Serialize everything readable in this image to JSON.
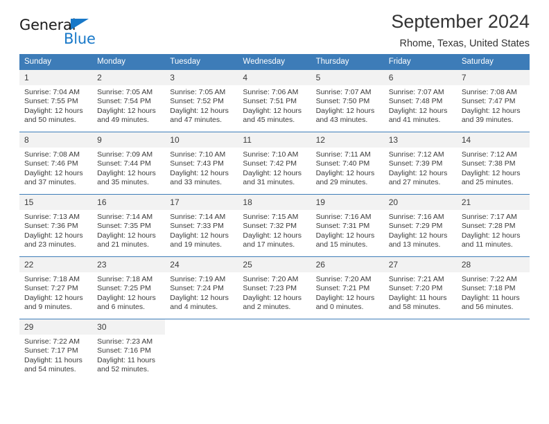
{
  "brand": {
    "name_top": "General",
    "name_bottom": "Blue",
    "triangle_icon": "triangle-icon",
    "accent_color": "#1878c8"
  },
  "header": {
    "title": "September 2024",
    "subtitle": "Rhome, Texas, United States"
  },
  "theme": {
    "header_blue": "#3d7cb8",
    "daynum_gray": "#f2f2f2",
    "text_color": "#3a3a3a"
  },
  "calendar": {
    "weekday_headers": [
      "Sunday",
      "Monday",
      "Tuesday",
      "Wednesday",
      "Thursday",
      "Friday",
      "Saturday"
    ],
    "weeks": [
      [
        {
          "day": "1",
          "sunrise": "Sunrise: 7:04 AM",
          "sunset": "Sunset: 7:55 PM",
          "daylight_1": "Daylight: 12 hours",
          "daylight_2": "and 50 minutes."
        },
        {
          "day": "2",
          "sunrise": "Sunrise: 7:05 AM",
          "sunset": "Sunset: 7:54 PM",
          "daylight_1": "Daylight: 12 hours",
          "daylight_2": "and 49 minutes."
        },
        {
          "day": "3",
          "sunrise": "Sunrise: 7:05 AM",
          "sunset": "Sunset: 7:52 PM",
          "daylight_1": "Daylight: 12 hours",
          "daylight_2": "and 47 minutes."
        },
        {
          "day": "4",
          "sunrise": "Sunrise: 7:06 AM",
          "sunset": "Sunset: 7:51 PM",
          "daylight_1": "Daylight: 12 hours",
          "daylight_2": "and 45 minutes."
        },
        {
          "day": "5",
          "sunrise": "Sunrise: 7:07 AM",
          "sunset": "Sunset: 7:50 PM",
          "daylight_1": "Daylight: 12 hours",
          "daylight_2": "and 43 minutes."
        },
        {
          "day": "6",
          "sunrise": "Sunrise: 7:07 AM",
          "sunset": "Sunset: 7:48 PM",
          "daylight_1": "Daylight: 12 hours",
          "daylight_2": "and 41 minutes."
        },
        {
          "day": "7",
          "sunrise": "Sunrise: 7:08 AM",
          "sunset": "Sunset: 7:47 PM",
          "daylight_1": "Daylight: 12 hours",
          "daylight_2": "and 39 minutes."
        }
      ],
      [
        {
          "day": "8",
          "sunrise": "Sunrise: 7:08 AM",
          "sunset": "Sunset: 7:46 PM",
          "daylight_1": "Daylight: 12 hours",
          "daylight_2": "and 37 minutes."
        },
        {
          "day": "9",
          "sunrise": "Sunrise: 7:09 AM",
          "sunset": "Sunset: 7:44 PM",
          "daylight_1": "Daylight: 12 hours",
          "daylight_2": "and 35 minutes."
        },
        {
          "day": "10",
          "sunrise": "Sunrise: 7:10 AM",
          "sunset": "Sunset: 7:43 PM",
          "daylight_1": "Daylight: 12 hours",
          "daylight_2": "and 33 minutes."
        },
        {
          "day": "11",
          "sunrise": "Sunrise: 7:10 AM",
          "sunset": "Sunset: 7:42 PM",
          "daylight_1": "Daylight: 12 hours",
          "daylight_2": "and 31 minutes."
        },
        {
          "day": "12",
          "sunrise": "Sunrise: 7:11 AM",
          "sunset": "Sunset: 7:40 PM",
          "daylight_1": "Daylight: 12 hours",
          "daylight_2": "and 29 minutes."
        },
        {
          "day": "13",
          "sunrise": "Sunrise: 7:12 AM",
          "sunset": "Sunset: 7:39 PM",
          "daylight_1": "Daylight: 12 hours",
          "daylight_2": "and 27 minutes."
        },
        {
          "day": "14",
          "sunrise": "Sunrise: 7:12 AM",
          "sunset": "Sunset: 7:38 PM",
          "daylight_1": "Daylight: 12 hours",
          "daylight_2": "and 25 minutes."
        }
      ],
      [
        {
          "day": "15",
          "sunrise": "Sunrise: 7:13 AM",
          "sunset": "Sunset: 7:36 PM",
          "daylight_1": "Daylight: 12 hours",
          "daylight_2": "and 23 minutes."
        },
        {
          "day": "16",
          "sunrise": "Sunrise: 7:14 AM",
          "sunset": "Sunset: 7:35 PM",
          "daylight_1": "Daylight: 12 hours",
          "daylight_2": "and 21 minutes."
        },
        {
          "day": "17",
          "sunrise": "Sunrise: 7:14 AM",
          "sunset": "Sunset: 7:33 PM",
          "daylight_1": "Daylight: 12 hours",
          "daylight_2": "and 19 minutes."
        },
        {
          "day": "18",
          "sunrise": "Sunrise: 7:15 AM",
          "sunset": "Sunset: 7:32 PM",
          "daylight_1": "Daylight: 12 hours",
          "daylight_2": "and 17 minutes."
        },
        {
          "day": "19",
          "sunrise": "Sunrise: 7:16 AM",
          "sunset": "Sunset: 7:31 PM",
          "daylight_1": "Daylight: 12 hours",
          "daylight_2": "and 15 minutes."
        },
        {
          "day": "20",
          "sunrise": "Sunrise: 7:16 AM",
          "sunset": "Sunset: 7:29 PM",
          "daylight_1": "Daylight: 12 hours",
          "daylight_2": "and 13 minutes."
        },
        {
          "day": "21",
          "sunrise": "Sunrise: 7:17 AM",
          "sunset": "Sunset: 7:28 PM",
          "daylight_1": "Daylight: 12 hours",
          "daylight_2": "and 11 minutes."
        }
      ],
      [
        {
          "day": "22",
          "sunrise": "Sunrise: 7:18 AM",
          "sunset": "Sunset: 7:27 PM",
          "daylight_1": "Daylight: 12 hours",
          "daylight_2": "and 9 minutes."
        },
        {
          "day": "23",
          "sunrise": "Sunrise: 7:18 AM",
          "sunset": "Sunset: 7:25 PM",
          "daylight_1": "Daylight: 12 hours",
          "daylight_2": "and 6 minutes."
        },
        {
          "day": "24",
          "sunrise": "Sunrise: 7:19 AM",
          "sunset": "Sunset: 7:24 PM",
          "daylight_1": "Daylight: 12 hours",
          "daylight_2": "and 4 minutes."
        },
        {
          "day": "25",
          "sunrise": "Sunrise: 7:20 AM",
          "sunset": "Sunset: 7:23 PM",
          "daylight_1": "Daylight: 12 hours",
          "daylight_2": "and 2 minutes."
        },
        {
          "day": "26",
          "sunrise": "Sunrise: 7:20 AM",
          "sunset": "Sunset: 7:21 PM",
          "daylight_1": "Daylight: 12 hours",
          "daylight_2": "and 0 minutes."
        },
        {
          "day": "27",
          "sunrise": "Sunrise: 7:21 AM",
          "sunset": "Sunset: 7:20 PM",
          "daylight_1": "Daylight: 11 hours",
          "daylight_2": "and 58 minutes."
        },
        {
          "day": "28",
          "sunrise": "Sunrise: 7:22 AM",
          "sunset": "Sunset: 7:18 PM",
          "daylight_1": "Daylight: 11 hours",
          "daylight_2": "and 56 minutes."
        }
      ],
      [
        {
          "day": "29",
          "sunrise": "Sunrise: 7:22 AM",
          "sunset": "Sunset: 7:17 PM",
          "daylight_1": "Daylight: 11 hours",
          "daylight_2": "and 54 minutes."
        },
        {
          "day": "30",
          "sunrise": "Sunrise: 7:23 AM",
          "sunset": "Sunset: 7:16 PM",
          "daylight_1": "Daylight: 11 hours",
          "daylight_2": "and 52 minutes."
        },
        {
          "day": "",
          "sunrise": "",
          "sunset": "",
          "daylight_1": "",
          "daylight_2": ""
        },
        {
          "day": "",
          "sunrise": "",
          "sunset": "",
          "daylight_1": "",
          "daylight_2": ""
        },
        {
          "day": "",
          "sunrise": "",
          "sunset": "",
          "daylight_1": "",
          "daylight_2": ""
        },
        {
          "day": "",
          "sunrise": "",
          "sunset": "",
          "daylight_1": "",
          "daylight_2": ""
        },
        {
          "day": "",
          "sunrise": "",
          "sunset": "",
          "daylight_1": "",
          "daylight_2": ""
        }
      ]
    ]
  }
}
